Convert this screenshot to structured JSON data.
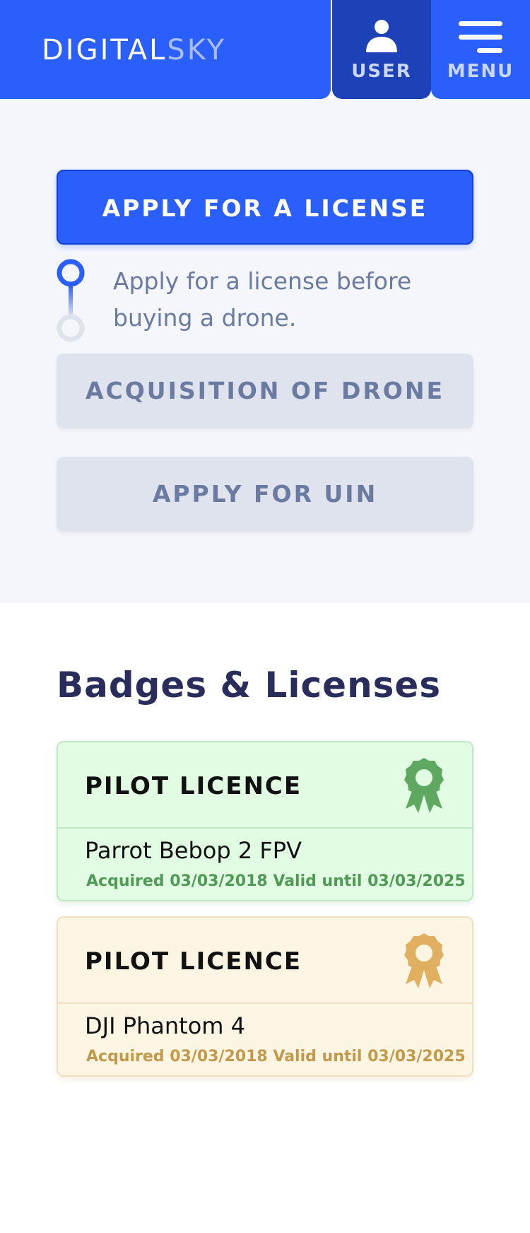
{
  "header": {
    "logo_part1": "DIGITAL",
    "logo_part2": "SKY",
    "user_label": "USER",
    "menu_label": "MENU"
  },
  "steps": {
    "apply_license_label": "APPLY FOR A LICENSE",
    "note": "Apply for a license before buying a drone.",
    "acquisition_label": "ACQUISITION OF DRONE",
    "apply_uin_label": "APPLY FOR UIN"
  },
  "badges": {
    "title": "Badges & Licenses",
    "cards": [
      {
        "title": "PILOT LICENCE",
        "drone": "Parrot Bebop 2 FPV",
        "meta": "Acquired 03/03/2018 Valid until 03/03/2025",
        "icon": "award-ribbon-icon",
        "color": "#5fa862"
      },
      {
        "title": "PILOT LICENCE",
        "drone": "DJI Phantom 4",
        "meta": "Acquired 03/03/2018 Valid until 03/03/2025",
        "icon": "award-ribbon-icon",
        "color": "#e0b060"
      }
    ]
  },
  "colors": {
    "primary": "#2a5ffc",
    "primary_dark": "#1d42b8",
    "disabled_bg": "#dfe3ee",
    "disabled_text": "#6b7aa0",
    "title_text": "#2a2d5c"
  }
}
